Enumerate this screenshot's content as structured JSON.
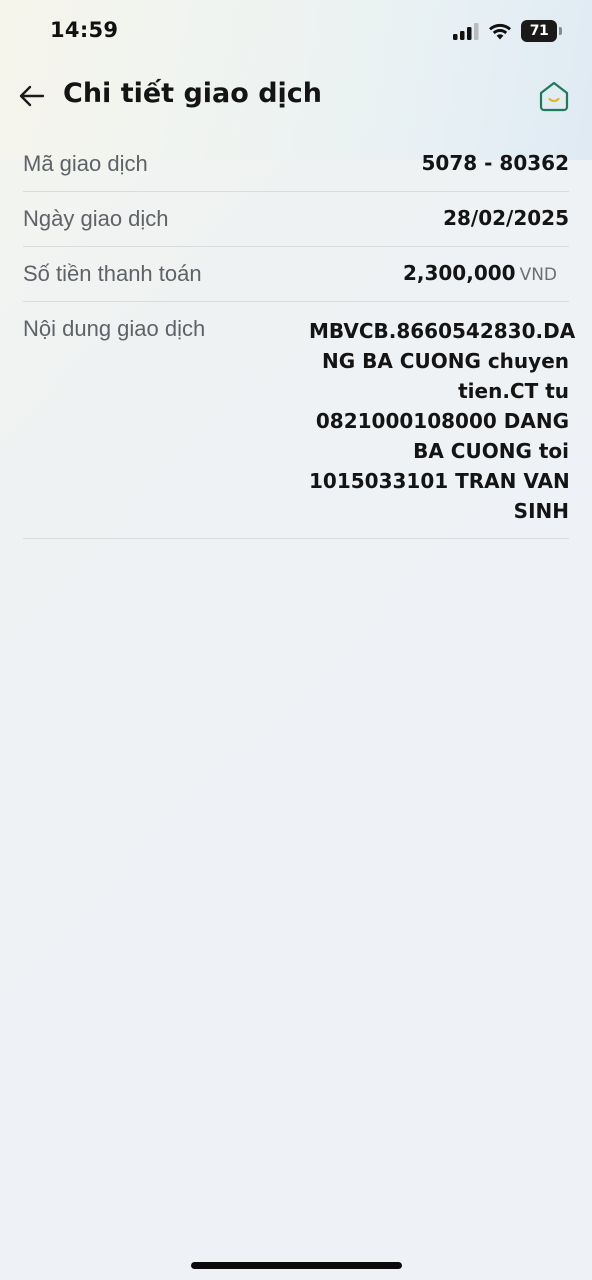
{
  "status_bar": {
    "time": "14:59",
    "battery_level": "71"
  },
  "header": {
    "title": "Chi tiết giao dịch",
    "back_icon": "arrow-left-icon",
    "home_icon": "home-smile-icon",
    "accent_color": "#1e7a5a"
  },
  "details": {
    "transaction_id": {
      "label": "Mã giao dịch",
      "value": "5078 - 80362"
    },
    "transaction_date": {
      "label": "Ngày giao dịch",
      "value": "28/02/2025"
    },
    "amount": {
      "label": "Số tiền thanh toán",
      "value": "2,300,000",
      "currency": "VND"
    },
    "content": {
      "label": "Nội dung giao dịch",
      "lines": [
        "MBVCB.8660542830.DA",
        "NG BA CUONG chuyen",
        "tien.CT tu",
        "0821000108000 DANG",
        "BA CUONG toi",
        "1015033101 TRAN VAN",
        "SINH"
      ]
    }
  }
}
